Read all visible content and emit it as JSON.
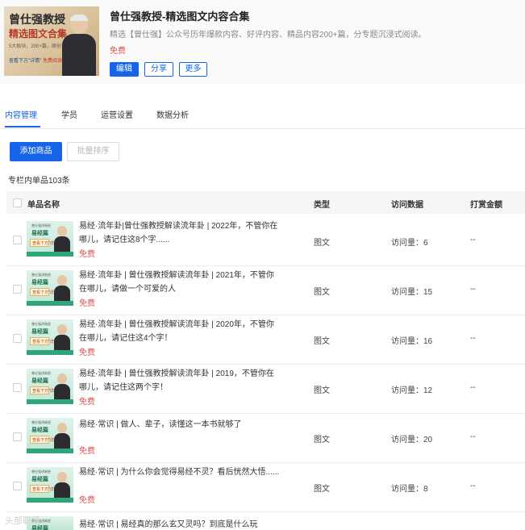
{
  "header": {
    "cover": {
      "line1": "曾仕强教授",
      "line2": "精选图文合集",
      "line3": "5大板块，200+篇，原创",
      "line4": "查看下方\"详情\"",
      "line5": "免费阅读"
    },
    "title": "曾仕强教授-精选图文内容合集",
    "desc": "精选【曾仕强】公众号历年爆款内容、好评内容、精品内容200+篇，分专题沉浸式阅读。",
    "price": "免费",
    "buttons": {
      "edit": "编辑",
      "share": "分享",
      "more": "更多"
    }
  },
  "tabs": [
    "内容管理",
    "学员",
    "运营设置",
    "数据分析"
  ],
  "actions": {
    "add": "添加商品",
    "sort": "批量排序"
  },
  "count_label": "专栏内单品103条",
  "table": {
    "headers": {
      "name": "单品名称",
      "type": "类型",
      "visits": "访问数据",
      "tips": "打赏金额"
    },
    "thumb": {
      "top": "曾仕强讲易经",
      "name": "易经篇",
      "badge": "查看下方\"详情\""
    },
    "rows": [
      {
        "title": "易经·流年卦|曾仕强教授解读流年卦 | 2022年，不管你在哪儿，请记住这8个字......",
        "price": "免费",
        "type": "图文",
        "visits": "访问量：6",
        "tip": "--"
      },
      {
        "title": "易经·流年卦 | 曾仕强教授解读流年卦 | 2021年，不管你在哪儿，请做一个可爱的人",
        "price": "免费",
        "type": "图文",
        "visits": "访问量：15",
        "tip": "--"
      },
      {
        "title": "易经·流年卦 | 曾仕强教授解读流年卦 | 2020年，不管你在哪儿，请记住这4个字！",
        "price": "免费",
        "type": "图文",
        "visits": "访问量：16",
        "tip": "--"
      },
      {
        "title": "易经·流年卦 | 曾仕强教授解读流年卦 | 2019，不管你在哪儿，请记住这两个字！",
        "price": "免费",
        "type": "图文",
        "visits": "访问量：12",
        "tip": "--"
      },
      {
        "title": "易经·常识 | 做人、辈子，读懂这一本书就够了",
        "price": "免费",
        "type": "图文",
        "visits": "访问量：20",
        "tip": "--"
      },
      {
        "title": "易经·常识 | 为什么你会觉得易经不灵？看后恍然大悟......",
        "price": "免费",
        "type": "图文",
        "visits": "访问量：8",
        "tip": "--"
      },
      {
        "title": "易经·常识 | 易经真的那么玄又灵吗？到底是什么玩",
        "price": "",
        "type": "",
        "visits": "",
        "tip": ""
      }
    ]
  },
  "watermark": "头部职场"
}
